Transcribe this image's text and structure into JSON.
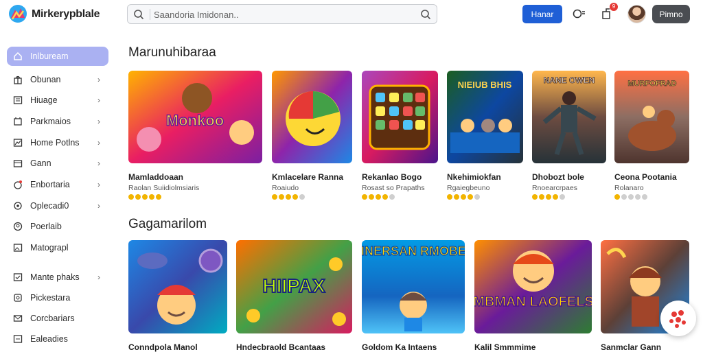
{
  "app": {
    "brand": "Mirkerypblale"
  },
  "search": {
    "placeholder": "Saandoria Imidonan.."
  },
  "header": {
    "primary_button": "Hanar",
    "dark_button": "Pimno",
    "notification_count": "9"
  },
  "sidebar": {
    "items": [
      {
        "label": "Inlbuream",
        "icon": "home-icon",
        "chevron": false,
        "active": true
      },
      {
        "label": "Obunan",
        "icon": "gift-icon",
        "chevron": true
      },
      {
        "label": "Hiuage",
        "icon": "image-icon",
        "chevron": true
      },
      {
        "label": "Parkmaios",
        "icon": "bookmark-icon",
        "chevron": true
      },
      {
        "label": "Home Potlns",
        "icon": "chart-icon",
        "chevron": true
      },
      {
        "label": "Gann",
        "icon": "gamepad-icon",
        "chevron": true
      },
      {
        "label": "Enbortaria",
        "icon": "bell-icon",
        "chevron": true
      },
      {
        "label": "Oplecadi0",
        "icon": "settings-icon",
        "chevron": true
      },
      {
        "label": "Poerlaib",
        "icon": "user-icon",
        "chevron": false
      },
      {
        "label": "Matograpl",
        "icon": "photo-icon",
        "chevron": false
      },
      {
        "label": "Mante phaks",
        "icon": "check-icon",
        "chevron": true
      },
      {
        "label": "Pickestara",
        "icon": "star-icon",
        "chevron": false
      },
      {
        "label": "Corcbariars",
        "icon": "mail-icon",
        "chevron": false
      },
      {
        "label": "Ealeadies",
        "icon": "list-icon",
        "chevron": false
      }
    ]
  },
  "sections": [
    {
      "title": "Marunuhibaraa",
      "cards": [
        {
          "title": "Mamladdoaan",
          "subtitle": "Raolan Suiidiolmsiaris",
          "rating": 5,
          "art_text": "Monkoo",
          "colors": [
            "#ffb300",
            "#e91e63",
            "#7b1fa2"
          ]
        },
        {
          "title": "Kmlacelare Ranna",
          "subtitle": "Roaiudo",
          "rating": 4,
          "art_text": "",
          "colors": [
            "#ff9800",
            "#8e24aa",
            "#1e88e5"
          ]
        },
        {
          "title": "Rekanlao Bogo",
          "subtitle": "Rosast so Prapaths",
          "rating": 4,
          "art_text": "",
          "colors": [
            "#ab47bc",
            "#d81b60",
            "#4a148c"
          ]
        },
        {
          "title": "Nkehimiokfan",
          "subtitle": "Rgaiegbeuno",
          "rating": 4,
          "art_text": "NIEIUB BHIS",
          "colors": [
            "#1b5e20",
            "#0d47a1",
            "#263238"
          ]
        },
        {
          "title": "Dhobozt bole",
          "subtitle": "Rnoearcrpaes",
          "rating": 4,
          "art_text": "NANE OWEN",
          "colors": [
            "#ffb74d",
            "#6d4c41",
            "#263238"
          ]
        },
        {
          "title": "Ceona Pootania",
          "subtitle": "Rolanaro",
          "rating": 1,
          "art_text": "MURFOFRAD",
          "colors": [
            "#ff7043",
            "#8d6e63",
            "#4e342e"
          ]
        }
      ]
    },
    {
      "title": "Gagamarilom",
      "cards": [
        {
          "title": "Conndpola Manol",
          "art_text": "",
          "colors": [
            "#1e88e5",
            "#3949ab",
            "#00acc1"
          ]
        },
        {
          "title": "Hndecbraold Bcantaas",
          "art_text": "HIIPAX",
          "colors": [
            "#ff6f00",
            "#43a047",
            "#d81b60"
          ]
        },
        {
          "title": "Goldom Ka Intaens",
          "art_text": "NINERSAN RMOBES",
          "colors": [
            "#039be5",
            "#1565c0",
            "#4fc3f7"
          ]
        },
        {
          "title": "Kalil Smmmime",
          "art_text": "MBMAN LAOFELS",
          "colors": [
            "#ff8f00",
            "#6a1b9a",
            "#2e7d32"
          ]
        },
        {
          "title": "Sanmclar Gann",
          "art_text": "",
          "colors": [
            "#ff7043",
            "#5d4037",
            "#1e88e5"
          ]
        }
      ]
    }
  ],
  "colors": {
    "accent": "#1f5fd6",
    "sidebar_active": "#aab1f2",
    "star": "#f2b400"
  }
}
